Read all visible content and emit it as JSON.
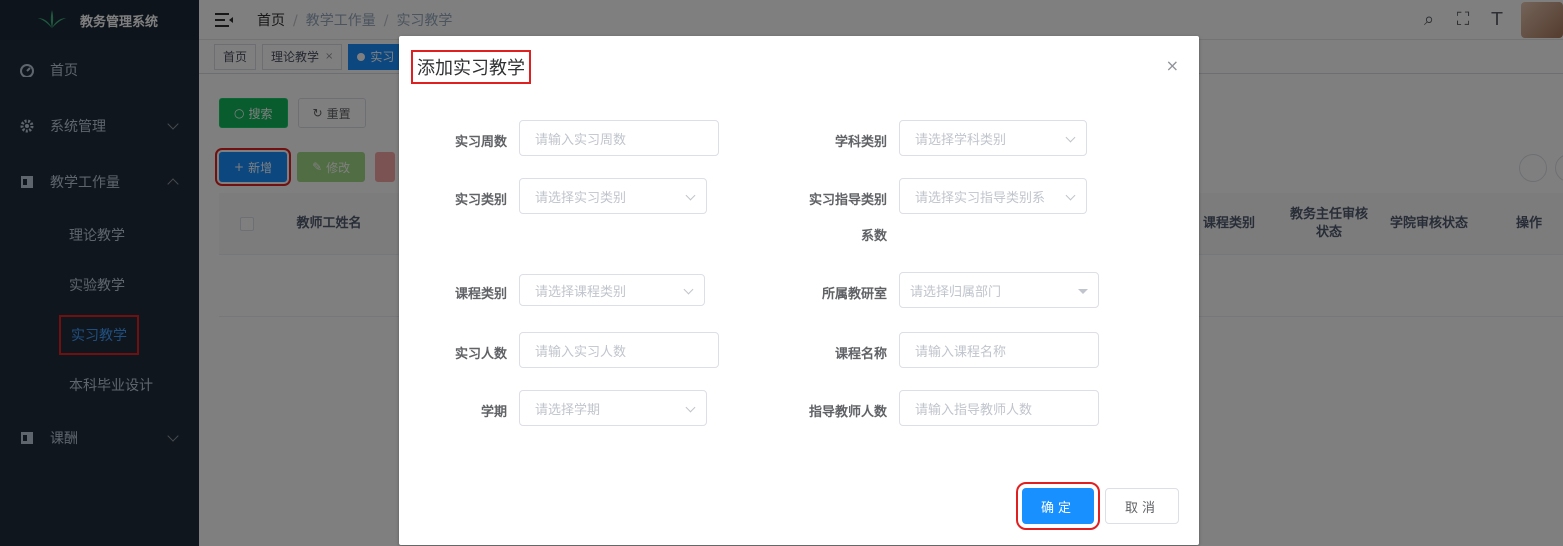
{
  "app": {
    "title": "教务管理系统"
  },
  "sidebar": {
    "items": [
      {
        "label": "首页",
        "icon": "dashboard-icon"
      },
      {
        "label": "系统管理",
        "icon": "gear-icon"
      },
      {
        "label": "教学工作量",
        "icon": "document-icon"
      },
      {
        "label": "课酬",
        "icon": "money-icon"
      }
    ],
    "submenu": [
      "理论教学",
      "实验教学",
      "实习教学",
      "本科毕业设计"
    ],
    "active_sub": "实习教学"
  },
  "breadcrumb": [
    "首页",
    "教学工作量",
    "实习教学"
  ],
  "tags": [
    {
      "label": "首页"
    },
    {
      "label": "理论教学",
      "close": "×"
    },
    {
      "label": "实习"
    }
  ],
  "toolbar": {
    "search": "搜索",
    "reset": "重置",
    "add": "新增",
    "edit": "修改"
  },
  "table": {
    "headers": [
      "教师工姓名",
      "课程类别",
      "教务主任审核\n状态",
      "学院审核状态",
      "操作"
    ]
  },
  "dialog": {
    "title": "添加实习教学",
    "close": "×",
    "fields": [
      {
        "label": "实习周数",
        "placeholder": "请输入实习周数"
      },
      {
        "label": "学科类别",
        "placeholder": "请选择学科类别"
      },
      {
        "label": "实习类别",
        "placeholder": "请选择实习类别"
      },
      {
        "label": "实习指导类别",
        "label2": "系数",
        "placeholder": "请选择实习指导类别系"
      },
      {
        "label": "课程类别",
        "placeholder": "请选择课程类别"
      },
      {
        "label": "所属教研室",
        "placeholder": "请选择归属部门"
      },
      {
        "label": "实习人数",
        "placeholder": "请输入实习人数"
      },
      {
        "label": "课程名称",
        "placeholder": "请输入课程名称"
      },
      {
        "label": "学期",
        "placeholder": "请选择学期"
      },
      {
        "label": "指导教师人数",
        "placeholder": "请输入指导教师人数"
      }
    ],
    "confirm": "确定",
    "cancel": "取消"
  },
  "colors": {
    "primary": "#1890ff",
    "sidebar_bg": "#1f2d3d",
    "highlight": "#e02020"
  }
}
